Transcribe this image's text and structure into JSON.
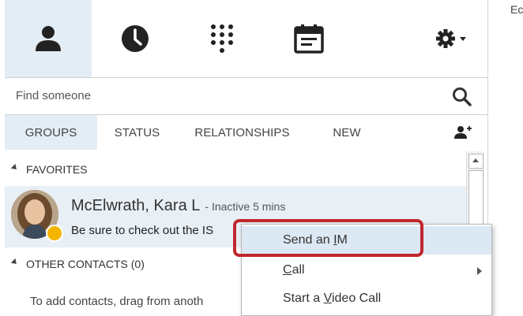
{
  "top_tabs": [
    {
      "name": "contacts",
      "icon": "person-icon",
      "active": true
    },
    {
      "name": "conversations",
      "icon": "clock-icon",
      "active": false
    },
    {
      "name": "phone",
      "icon": "dialpad-icon",
      "active": false
    },
    {
      "name": "meetings",
      "icon": "calendar-icon",
      "active": false
    }
  ],
  "options_icon": "gear-icon",
  "search": {
    "placeholder": "Find someone"
  },
  "filter_tabs": [
    "GROUPS",
    "STATUS",
    "RELATIONSHIPS",
    "NEW"
  ],
  "active_filter": "GROUPS",
  "add_contact_icon": "add-contact-icon",
  "groups": {
    "favorites": {
      "label": "FAVORITES"
    },
    "other": {
      "label": "OTHER CONTACTS (0)",
      "empty_text": "To add contacts, drag from anoth"
    }
  },
  "contact": {
    "name": "McElwrath, Kara L",
    "status": "- Inactive 5 mins",
    "note": "Be sure to check out the IS",
    "presence_color": "#f4b400"
  },
  "context_menu": {
    "items": [
      {
        "pre": "Send an ",
        "u": "I",
        "post": "M",
        "highlighted": true
      },
      {
        "pre": "",
        "u": "C",
        "post": "all",
        "submenu": true
      },
      {
        "pre": "Start a ",
        "u": "V",
        "post": "ideo Call"
      }
    ]
  },
  "right_pane": {
    "peek_text": "Ec"
  },
  "colors": {
    "active_tab": "#e3edf5",
    "highlight_box": "#c0272d",
    "menu_hover": "#dce8f4"
  }
}
